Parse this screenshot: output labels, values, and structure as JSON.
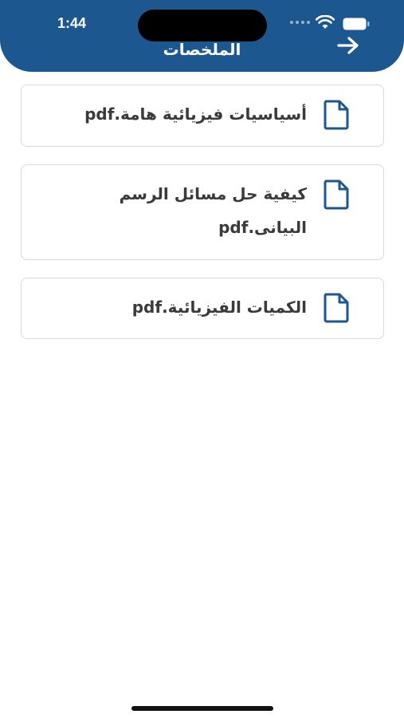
{
  "status_bar": {
    "time": "1:44"
  },
  "header": {
    "title": "الملخصات",
    "background": "#1d5790"
  },
  "files": [
    {
      "name": "أسياسيات فيزيائية هامة.pdf",
      "icon": "file-icon"
    },
    {
      "name": "كيفية حل مسائل الرسم البيانى.pdf",
      "icon": "file-icon"
    },
    {
      "name": "الكميات الفيزيائية.pdf",
      "icon": "file-icon"
    }
  ],
  "colors": {
    "accent": "#1d5790",
    "text": "#3a3a3a",
    "card_border": "#d9d9d9"
  }
}
